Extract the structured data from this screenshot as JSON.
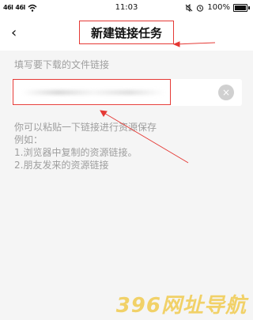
{
  "status_bar": {
    "signal_left": "46l",
    "signal_right": "46l",
    "wifi_icon": "wifi-icon",
    "time": "11:03",
    "alarm_icon": "alarm-icon",
    "battery": "100%"
  },
  "header": {
    "back_icon": "‹",
    "title": "新建链接任务"
  },
  "form": {
    "label": "填写要下载的文件链接",
    "input_value": "",
    "clear_icon": "×"
  },
  "hints": {
    "line1": "你可以粘贴一下链接进行资源保存",
    "line2": "例如：",
    "line3": "1.浏览器中复制的资源链接。",
    "line4": "2.朋友发来的资源链接"
  },
  "watermark": "396网址导航",
  "colors": {
    "annotation": "#e53935",
    "background": "#f5f5f5",
    "hint_text": "#9e9e9e",
    "watermark": "#f0c63a"
  }
}
